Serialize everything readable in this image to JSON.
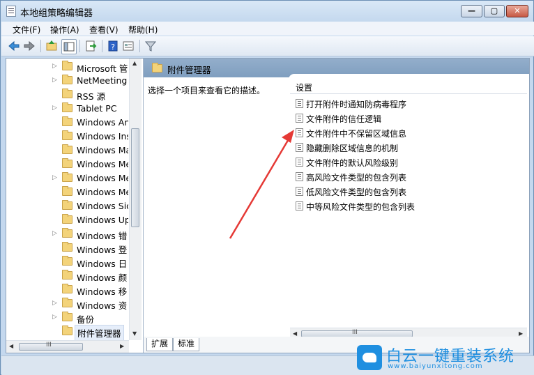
{
  "window": {
    "title": "本地组策略编辑器",
    "min_label": "—",
    "max_label": "▢",
    "close_label": "✕"
  },
  "menu": {
    "items": [
      "文件(F)",
      "操作(A)",
      "查看(V)",
      "帮助(H)"
    ]
  },
  "tree": {
    "items": [
      {
        "label": "Microsoft 管",
        "expandable": true
      },
      {
        "label": "NetMeeting",
        "expandable": true
      },
      {
        "label": "RSS 源",
        "expandable": false
      },
      {
        "label": "Tablet PC",
        "expandable": true
      },
      {
        "label": "Windows An",
        "expandable": false
      },
      {
        "label": "Windows Ins",
        "expandable": false
      },
      {
        "label": "Windows Ma",
        "expandable": false
      },
      {
        "label": "Windows Me",
        "expandable": false
      },
      {
        "label": "Windows Me",
        "expandable": true
      },
      {
        "label": "Windows Me",
        "expandable": false
      },
      {
        "label": "Windows Sid",
        "expandable": false
      },
      {
        "label": "Windows Up",
        "expandable": false
      },
      {
        "label": "Windows 错",
        "expandable": true
      },
      {
        "label": "Windows 登",
        "expandable": false
      },
      {
        "label": "Windows 日",
        "expandable": false
      },
      {
        "label": "Windows 颜",
        "expandable": false
      },
      {
        "label": "Windows 移",
        "expandable": false
      },
      {
        "label": "Windows 资",
        "expandable": true
      },
      {
        "label": "备份",
        "expandable": true
      },
      {
        "label": "附件管理器",
        "expandable": false,
        "selected": true
      }
    ]
  },
  "right": {
    "header_title": "附件管理器",
    "description": "选择一个项目来查看它的描述。",
    "column_header": "设置",
    "settings": [
      "打开附件时通知防病毒程序",
      "文件附件的信任逻辑",
      "文件附件中不保留区域信息",
      "隐藏删除区域信息的机制",
      "文件附件的默认风险级别",
      "高风险文件类型的包含列表",
      "低风险文件类型的包含列表",
      "中等风险文件类型的包含列表"
    ],
    "tabs": [
      "扩展",
      "标准"
    ]
  },
  "scroll_glyph": "III",
  "watermark": {
    "title": "白云一键重装系统",
    "url": "www.baiyunxitong.com"
  },
  "colors": {
    "accent": "#1f8fe0",
    "annotation_arrow": "#e53935"
  }
}
